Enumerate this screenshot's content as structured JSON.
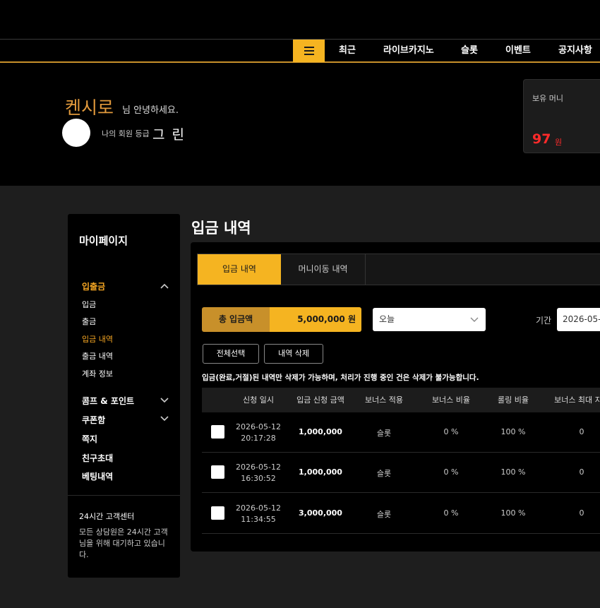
{
  "nav": {
    "menu_icon": "hamburger-icon",
    "items": [
      "최근",
      "라이브카지노",
      "슬롯",
      "이벤트",
      "공지사항"
    ]
  },
  "user": {
    "name": "켄시로",
    "greeting": "님 안녕하세요.",
    "grade_label": "나의 회원 등급",
    "grade": "그 린"
  },
  "wallet": {
    "label": "보유 머니",
    "amount": "97",
    "unit": "원"
  },
  "sidebar": {
    "title": "마이페이지",
    "deposit_group": "입출금",
    "deposit_items": [
      "입금",
      "출금",
      "입금 내역",
      "출금 내역",
      "계좌 정보"
    ],
    "other_items": [
      "콤프 & 포인트",
      "쿠폰함",
      "쪽지",
      "친구초대",
      "베팅내역"
    ],
    "support_title": "24시간 고객센터",
    "support_text": "모든 상담원은 24시간 고객님을 위해 대기하고 있습니다."
  },
  "page": {
    "title": "입금 내역",
    "tabs": [
      "입금 내역",
      "머니이동 내역"
    ],
    "total_label": "총 입금액",
    "total_value": "5,000,000 원",
    "period_select": "오늘",
    "period_label": "기간",
    "date_value": "2026-05-",
    "select_all": "전체선택",
    "delete": "내역 삭제",
    "notice": "입금(완료,거절)된 내역만 삭제가 가능하며, 처리가 진행 중인 건은 삭제가 불가능합니다."
  },
  "table": {
    "headers": [
      "신청 일시",
      "입금 신청 금액",
      "보너스 적용",
      "보너스 비율",
      "롤링 비율",
      "보너스 최대 지급"
    ],
    "rows": [
      {
        "date": "2026-05-12",
        "time": "20:17:28",
        "amount": "1,000,000",
        "bonus": "슬롯",
        "bonus_rate": "0 %",
        "rolling": "100 %",
        "max": "0"
      },
      {
        "date": "2026-05-12",
        "time": "16:30:52",
        "amount": "1,000,000",
        "bonus": "슬롯",
        "bonus_rate": "0 %",
        "rolling": "100 %",
        "max": "0"
      },
      {
        "date": "2026-05-12",
        "time": "11:34:55",
        "amount": "3,000,000",
        "bonus": "슬롯",
        "bonus_rate": "0 %",
        "rolling": "100 %",
        "max": "0"
      }
    ]
  },
  "colors": {
    "accent": "#f5b421",
    "accent_dark": "#c8902a",
    "money": "#ff2a2a",
    "name": "#e29a3c"
  }
}
